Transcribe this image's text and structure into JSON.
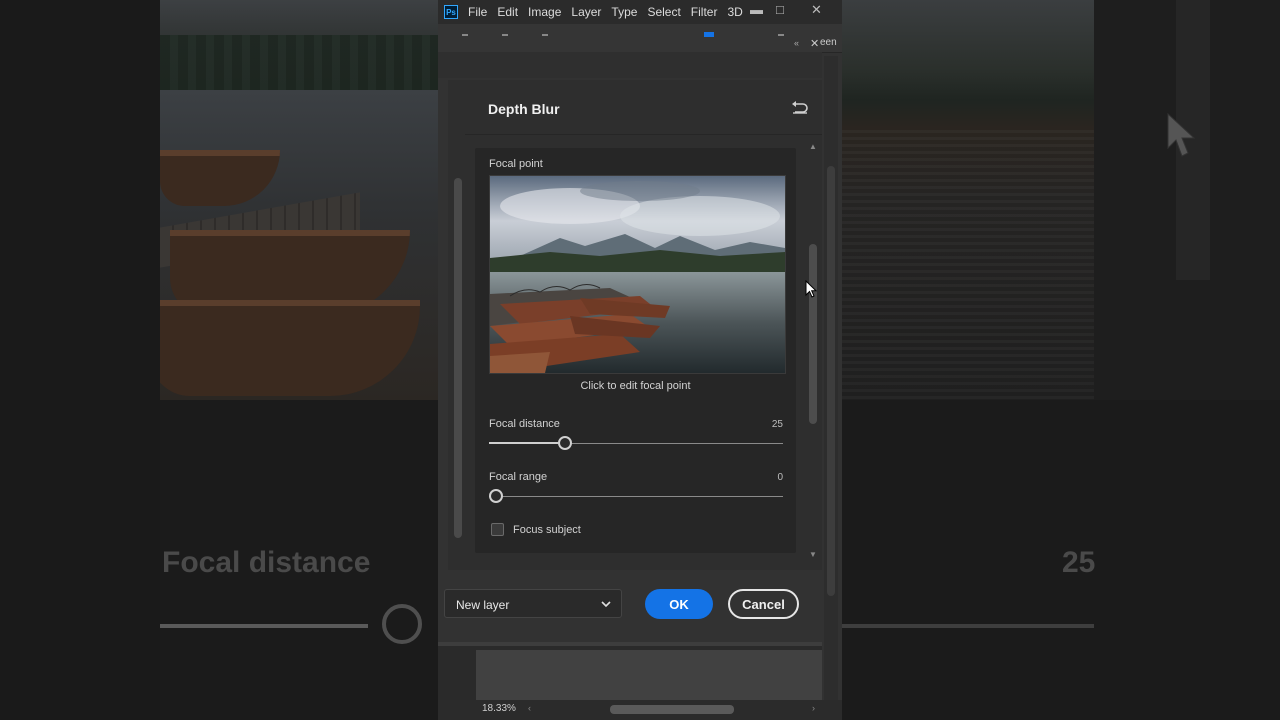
{
  "app": {
    "logo": "Ps",
    "menu": [
      "File",
      "Edit",
      "Image",
      "Layer",
      "Type",
      "Select",
      "Filter",
      "3D"
    ],
    "window_controls": {
      "minimize": "▬",
      "maximize": "□",
      "close": "✕"
    },
    "options_bar": {
      "collapse": "«",
      "close": "✕",
      "screen_text": "een"
    }
  },
  "background": {
    "focal_distance_label": "Focal distance",
    "focal_distance_value": "25"
  },
  "panel": {
    "title": "Depth Blur",
    "reset_icon": "reset-icon",
    "focal_point_label": "Focal point",
    "focal_point_caption": "Click to edit focal point",
    "focal_distance": {
      "label": "Focal distance",
      "value": "25",
      "fraction": 0.26
    },
    "focal_range": {
      "label": "Focal range",
      "value": "0",
      "fraction": 0.0
    },
    "focus_subject": {
      "label": "Focus subject",
      "checked": false
    }
  },
  "footer": {
    "output_select": "New layer",
    "ok_label": "OK",
    "cancel_label": "Cancel"
  },
  "status": {
    "zoom": "18.33%"
  },
  "colors": {
    "accent": "#1473e6",
    "panel_bg": "#2e2e2e",
    "window_bg": "#323232"
  }
}
